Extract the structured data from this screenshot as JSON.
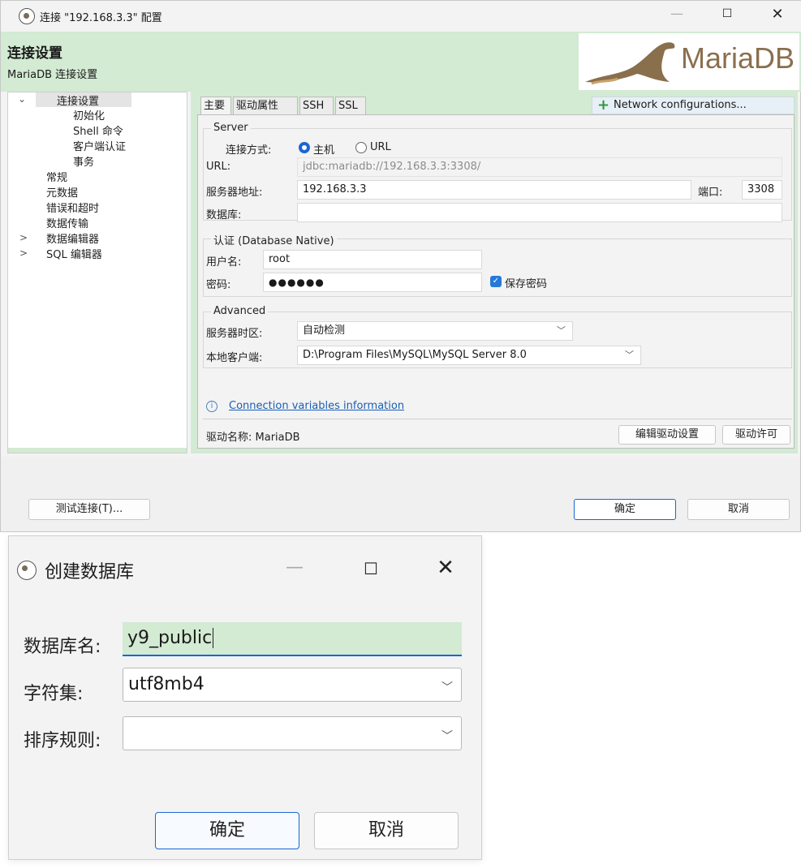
{
  "window1": {
    "title": "连接 \"192.168.3.3\" 配置",
    "header": {
      "title": "连接设置",
      "subtitle": "MariaDB 连接设置",
      "logo_text": "MariaDB"
    },
    "tree": [
      {
        "label": "连接设置"
      },
      {
        "label": "初始化"
      },
      {
        "label": "Shell 命令"
      },
      {
        "label": "客户端认证"
      },
      {
        "label": "事务"
      },
      {
        "label": "常规"
      },
      {
        "label": "元数据"
      },
      {
        "label": "错误和超时"
      },
      {
        "label": "数据传输"
      },
      {
        "label": "数据编辑器"
      },
      {
        "label": "SQL 编辑器"
      }
    ],
    "tabs": [
      "主要",
      "驱动属性",
      "SSH",
      "SSL"
    ],
    "network_button": "Network configurations...",
    "server": {
      "legend": "Server",
      "connect_mode_label": "连接方式:",
      "mode_host": "主机",
      "mode_url": "URL",
      "url_label": "URL:",
      "url_value": "jdbc:mariadb://192.168.3.3:3308/",
      "host_label": "服务器地址:",
      "host_value": "192.168.3.3",
      "port_label": "端口:",
      "port_value": "3308",
      "db_label": "数据库:",
      "db_value": ""
    },
    "auth": {
      "legend": "认证 (Database Native)",
      "user_label": "用户名:",
      "user_value": "root",
      "pass_label": "密码:",
      "pass_value": "●●●●●●",
      "save_password": "保存密码"
    },
    "advanced": {
      "legend": "Advanced",
      "timezone_label": "服务器时区:",
      "timezone_value": "自动检测",
      "client_label": "本地客户端:",
      "client_value": "D:\\Program Files\\MySQL\\MySQL Server 8.0"
    },
    "conn_vars_link": "Connection variables information",
    "driver_label": "驱动名称: MariaDB",
    "edit_driver": "编辑驱动设置",
    "driver_license": "驱动许可",
    "test_button": "测试连接(T)...",
    "ok": "确定",
    "cancel": "取消"
  },
  "window2": {
    "title": "创建数据库",
    "name_label": "数据库名:",
    "name_value": "y9_public",
    "charset_label": "字符集:",
    "charset_value": "utf8mb4",
    "collation_label": "排序规则:",
    "collation_value": "",
    "ok": "确定",
    "cancel": "取消"
  },
  "colors": {
    "header_bg": "#d3ead3",
    "accent_blue": "#1a66d6",
    "network_plus": "#2e9a3a"
  },
  "icons": [
    "app-icon",
    "minimize-icon",
    "maximize-icon",
    "close-icon",
    "plus-icon",
    "info-icon",
    "chevron-down-icon",
    "expand-arrow-icon"
  ]
}
